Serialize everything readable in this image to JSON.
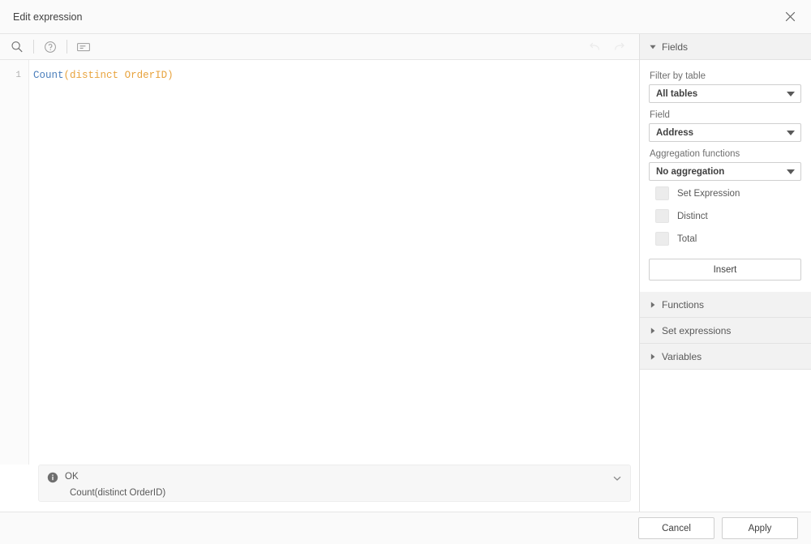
{
  "dialog": {
    "title": "Edit expression",
    "close_icon": "close-icon"
  },
  "toolbar": {
    "search_icon": "search-icon",
    "help_icon": "help-circle-icon",
    "snippet_icon": "expression-snippet-icon",
    "undo_icon": "undo-icon",
    "redo_icon": "redo-icon"
  },
  "editor": {
    "line_number": "1",
    "tokens": {
      "func": "Count",
      "open_paren": "(",
      "keyword": "distinct",
      "space": " ",
      "field": "OrderID",
      "close_paren": ")"
    }
  },
  "status": {
    "icon": "info-icon",
    "title": "OK",
    "preview": "Count(distinct OrderID)",
    "chevron_icon": "chevron-down-icon"
  },
  "panel": {
    "fields_section": {
      "label": "Fields",
      "expanded": true,
      "filter_by_table_label": "Filter by table",
      "filter_by_table_value": "All tables",
      "field_label": "Field",
      "field_value": "Address",
      "aggregation_label": "Aggregation functions",
      "aggregation_value": "No aggregation",
      "checkboxes": [
        {
          "label": "Set Expression",
          "checked": false
        },
        {
          "label": "Distinct",
          "checked": false
        },
        {
          "label": "Total",
          "checked": false
        }
      ],
      "insert_label": "Insert"
    },
    "collapsed_sections": [
      {
        "label": "Functions"
      },
      {
        "label": "Set expressions"
      },
      {
        "label": "Variables"
      }
    ]
  },
  "footer": {
    "cancel_label": "Cancel",
    "apply_label": "Apply"
  },
  "colors": {
    "token_function": "#4a7ebb",
    "token_keyword": "#e8a33d",
    "token_field": "#e8a33d",
    "panel_header_bg": "#f2f2f2",
    "status_bg": "#f7f7f7"
  }
}
